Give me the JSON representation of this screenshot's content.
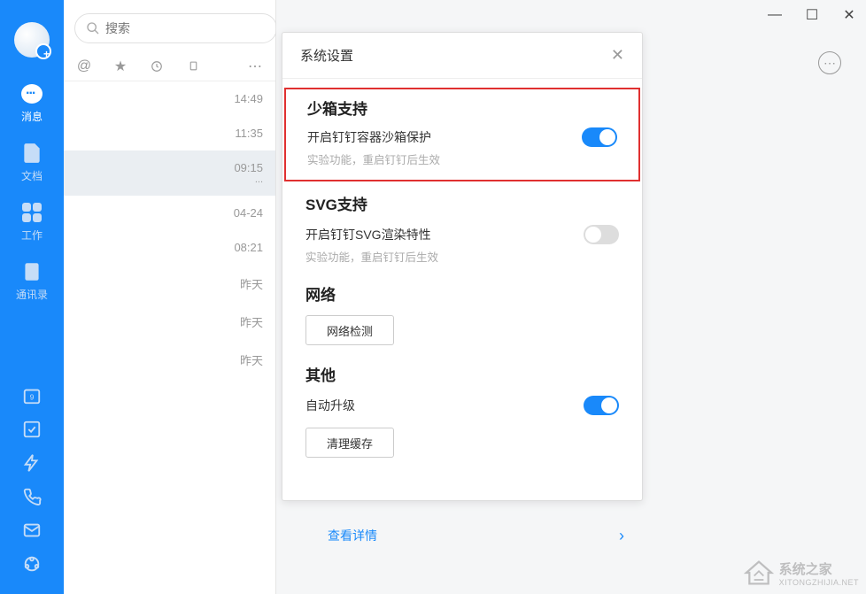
{
  "sidebar": {
    "items": [
      {
        "label": "消息"
      },
      {
        "label": "文档"
      },
      {
        "label": "工作"
      },
      {
        "label": "通讯录"
      }
    ]
  },
  "search": {
    "placeholder": "搜索"
  },
  "add_button": "+",
  "chat_list": [
    {
      "time": "14:49"
    },
    {
      "time": "11:35"
    },
    {
      "time": "09:15",
      "selected": true,
      "sub": "..."
    },
    {
      "time": "04-24"
    },
    {
      "time": "08:21"
    },
    {
      "time": "昨天"
    },
    {
      "time": "昨天"
    },
    {
      "time": "昨天"
    }
  ],
  "settings": {
    "title": "系统设置",
    "sandbox": {
      "title": "少箱支持",
      "label": "开启钉钉容器沙箱保护",
      "desc": "实验功能，重启钉钉后生效",
      "on": true
    },
    "svg": {
      "title": "SVG支持",
      "label": "开启钉钉SVG渲染特性",
      "desc": "实验功能，重启钉钉后生效",
      "on": false
    },
    "network": {
      "title": "网络",
      "button": "网络检测"
    },
    "other": {
      "title": "其他",
      "auto_upgrade": "自动升级",
      "auto_on": true,
      "clear_cache": "清理缓存"
    }
  },
  "view_details": "查看详情",
  "watermark": {
    "text": "系统之家",
    "subtext": "XITONGZHIJIA.NET"
  }
}
